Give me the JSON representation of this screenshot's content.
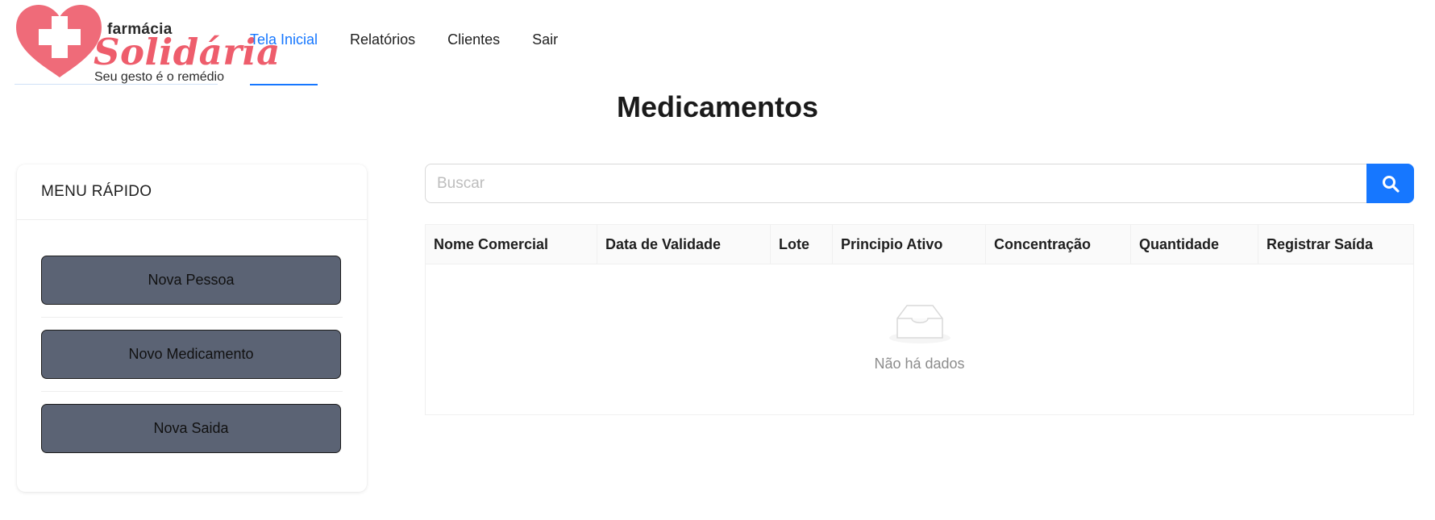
{
  "brand": {
    "top": "farmácia",
    "main": "Solidária",
    "tagline": "Seu gesto é o remédio",
    "heart_color": "#ef6b79",
    "accent_color": "#1677ff"
  },
  "nav": {
    "items": [
      {
        "label": "Tela Inicial",
        "active": true
      },
      {
        "label": "Relatórios",
        "active": false
      },
      {
        "label": "Clientes",
        "active": false
      },
      {
        "label": "Sair",
        "active": false
      }
    ]
  },
  "page": {
    "title": "Medicamentos"
  },
  "quick_menu": {
    "title": "MENU RÁPIDO",
    "buttons": [
      {
        "label": "Nova Pessoa"
      },
      {
        "label": "Novo Medicamento"
      },
      {
        "label": "Nova Saida"
      }
    ]
  },
  "search": {
    "placeholder": "Buscar",
    "value": "",
    "icon": "search-icon"
  },
  "table": {
    "columns": [
      "Nome Comercial",
      "Data de Validade",
      "Lote",
      "Principio Ativo",
      "Concentração",
      "Quantidade",
      "Registrar Saída"
    ],
    "rows": [],
    "empty_text": "Não há dados",
    "empty_icon": "empty-inbox-icon"
  }
}
